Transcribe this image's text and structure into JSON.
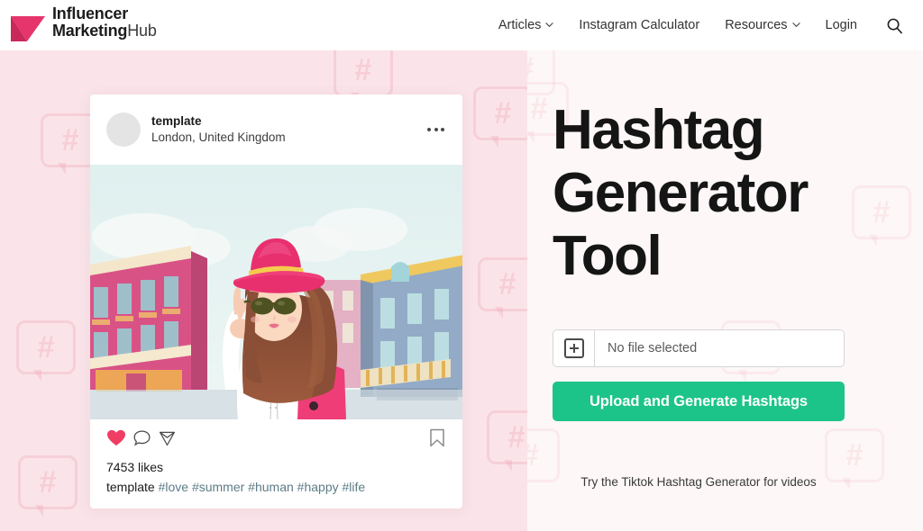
{
  "brand": {
    "line1": "Influencer",
    "line2_bold": "Marketing",
    "line2_rest": "Hub",
    "accent_color": "#e6356c"
  },
  "nav": {
    "items": [
      {
        "label": "Articles",
        "has_caret": true
      },
      {
        "label": "Instagram Calculator",
        "has_caret": false
      },
      {
        "label": "Resources",
        "has_caret": true
      },
      {
        "label": "Login",
        "has_caret": false
      }
    ],
    "search_icon": "search-icon"
  },
  "post": {
    "username": "template",
    "location": "London, United Kingdom",
    "more_icon": "ellipsis-icon",
    "actions": {
      "like_icon": "heart-icon",
      "comment_icon": "comment-icon",
      "share_icon": "paper-plane-icon",
      "save_icon": "bookmark-icon",
      "heart_color": "#ef3d64"
    },
    "likes": "7453 likes",
    "caption_author": "template",
    "caption_tags": "#love #summer #human #happy #life"
  },
  "hero": {
    "title": "Hashtag Generator Tool",
    "file_input": {
      "plus_icon": "plus-square-icon",
      "value": "No file selected",
      "placeholder": "No file selected"
    },
    "upload_button": "Upload and Generate Hashtags",
    "upload_button_color": "#1dc48a",
    "footer_link": "Try the Tiktok Hashtag Generator for videos"
  },
  "background": {
    "left_color": "#fae4e9",
    "right_color": "#fdf7f7",
    "pattern_glyph": "#"
  }
}
